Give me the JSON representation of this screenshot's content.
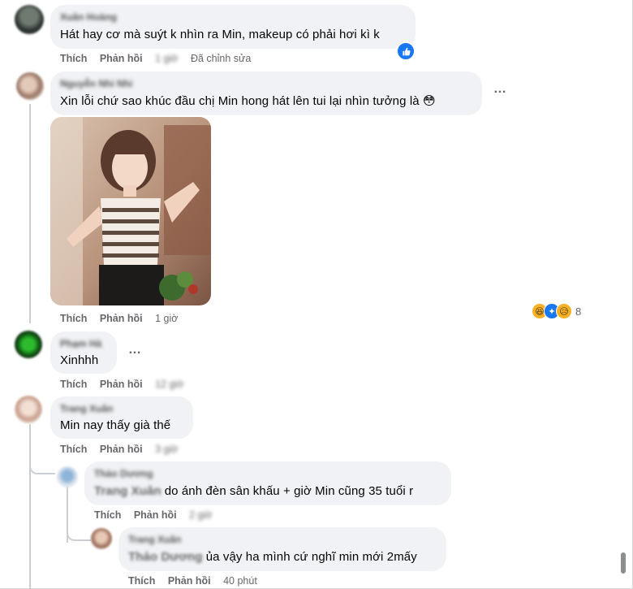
{
  "comments": [
    {
      "name": "Xuân Hoàng",
      "text": "Hát hay cơ mà suýt k nhìn ra Min, makeup có phải hơi kì k",
      "actions": {
        "like": "Thích",
        "reply": "Phản hồi",
        "time": "1 giờ",
        "edited": "Đã chỉnh sửa"
      },
      "reaction_icon": "thumbs-up-icon"
    },
    {
      "name": "Nguyễn Nhi Nhi",
      "text": "Xin lỗi chứ sao khúc đầu chị Min hong hát lên tui lại nhìn tưởng là 😳",
      "actions": {
        "like": "Thích",
        "reply": "Phản hồi",
        "time": "1 giờ"
      },
      "reaction_count": "8",
      "reaction_icons": [
        "haha-icon",
        "wow-icon",
        "sad-icon"
      ]
    },
    {
      "name": "Phạm Hà",
      "text": "Xinhhh",
      "actions": {
        "like": "Thích",
        "reply": "Phản hồi",
        "time": "12 giờ"
      }
    },
    {
      "name": "Trang Xuân",
      "text": "Min nay thấy già thế",
      "actions": {
        "like": "Thích",
        "reply": "Phản hồi",
        "time": "3 giờ"
      },
      "replies": [
        {
          "name": "Thảo Dương",
          "tag": "Trang Xuân",
          "text": "do ánh đèn sân khấu + giờ Min cũng 35 tuổi r",
          "actions": {
            "like": "Thích",
            "reply": "Phản hồi",
            "time": "2 giờ"
          }
        },
        {
          "name": "Trang Xuân",
          "tag": "Thảo Dương",
          "text": "ủa vậy ha mình cứ nghĩ min mới 2mấy",
          "actions": {
            "like": "Thích",
            "reply": "Phản hồi",
            "time": "40 phút"
          }
        }
      ]
    }
  ],
  "more_icon": "…",
  "colors": {
    "bubble": "#f0f2f5",
    "meta": "#65676b",
    "like_blue": "#1877f2"
  }
}
